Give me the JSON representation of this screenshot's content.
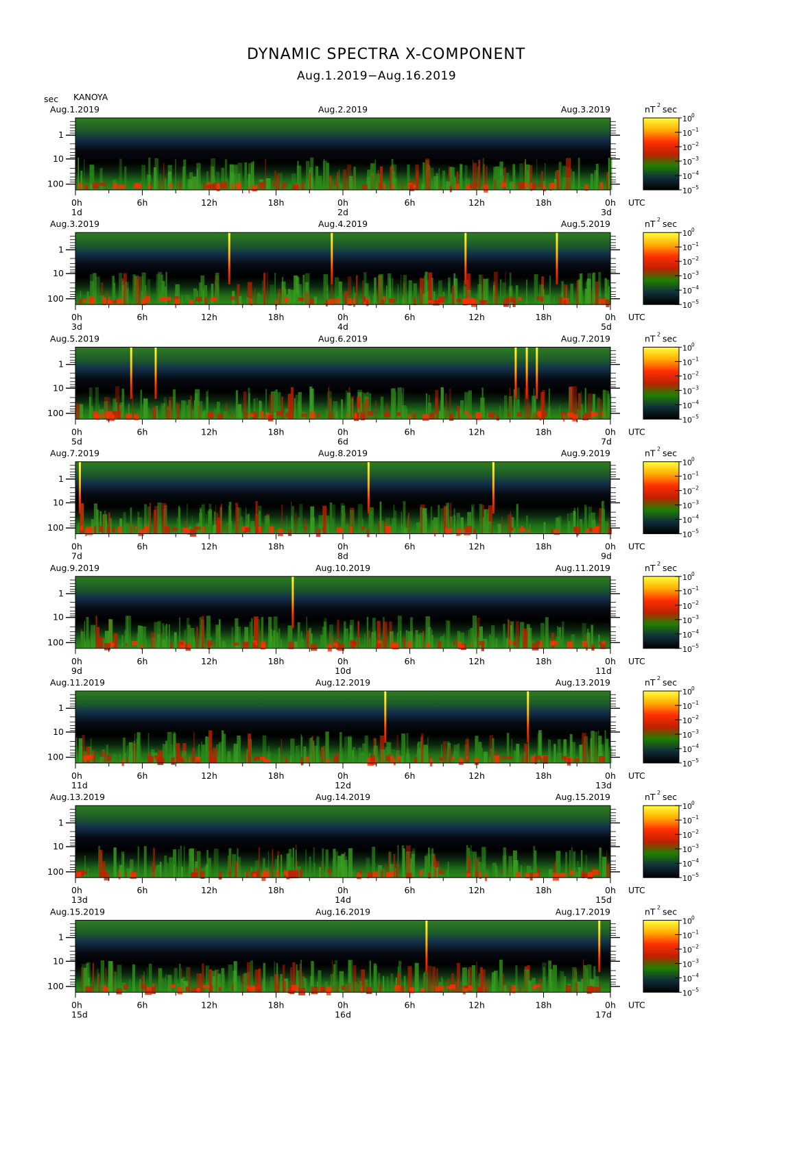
{
  "header": {
    "title": "DYNAMIC SPECTRA X-COMPONENT",
    "subtitle": "Aug.1.2019−Aug.16.2019",
    "yunit": "sec",
    "station": "KANOYA"
  },
  "colorbar": {
    "unit_base": "nT",
    "unit_exp": "2",
    "unit_suffix": "sec",
    "tick_base": "10",
    "tick_exps": [
      "0",
      "−1",
      "−2",
      "−3",
      "−4",
      "−5"
    ],
    "colors": [
      "#ffff40",
      "#ffb000",
      "#ff3000",
      "#c02000",
      "#208000",
      "#10303a",
      "#000000"
    ]
  },
  "axis": {
    "x_ticks": [
      "0h",
      "6h",
      "12h",
      "18h",
      "0h",
      "6h",
      "12h",
      "18h",
      "0h"
    ],
    "utc_label": "UTC",
    "y_ticks": [
      "1",
      "10",
      "100"
    ]
  },
  "chart_data": {
    "type": "heatmap",
    "quantity": "Power spectral density of geomagnetic X-component",
    "x_unit": "hour UTC",
    "y_unit": "period (sec)",
    "y_scale": "log",
    "ylim_period_sec": [
      0.2,
      200
    ],
    "color_scale": "log",
    "color_range": [
      1e-05,
      1
    ],
    "panels": [
      {
        "left_date": "Aug.1.2019",
        "mid_date": "Aug.2.2019",
        "right_date": "Aug.3.2019",
        "day_labels": [
          "1d",
          "2d",
          "3d"
        ],
        "spikes_hour": []
      },
      {
        "left_date": "Aug.3.2019",
        "mid_date": "Aug.4.2019",
        "right_date": "Aug.5.2019",
        "day_labels": [
          "3d",
          "4d",
          "5d"
        ],
        "spikes_hour": [
          13.8,
          23.0,
          35.0,
          43.2
        ]
      },
      {
        "left_date": "Aug.5.2019",
        "mid_date": "Aug.6.2019",
        "right_date": "Aug.7.2019",
        "day_labels": [
          "5d",
          "6d",
          "7d"
        ],
        "spikes_hour": [
          5.0,
          7.2,
          39.5,
          40.5,
          41.4
        ]
      },
      {
        "left_date": "Aug.7.2019",
        "mid_date": "Aug.8.2019",
        "right_date": "Aug.9.2019",
        "day_labels": [
          "7d",
          "8d",
          "9d"
        ],
        "spikes_hour": [
          0.4,
          26.3,
          37.5
        ]
      },
      {
        "left_date": "Aug.9.2019",
        "mid_date": "Aug.10.2019",
        "right_date": "Aug.11.2019",
        "day_labels": [
          "9d",
          "10d",
          "11d"
        ],
        "spikes_hour": [
          19.5
        ]
      },
      {
        "left_date": "Aug.11.2019",
        "mid_date": "Aug.12.2019",
        "right_date": "Aug.13.2019",
        "day_labels": [
          "11d",
          "12d",
          "13d"
        ],
        "spikes_hour": [
          27.8,
          40.6
        ]
      },
      {
        "left_date": "Aug.13.2019",
        "mid_date": "Aug.14.2019",
        "right_date": "Aug.15.2019",
        "day_labels": [
          "13d",
          "14d",
          "15d"
        ],
        "spikes_hour": []
      },
      {
        "left_date": "Aug.15.2019",
        "mid_date": "Aug.16.2019",
        "right_date": "Aug.17.2019",
        "day_labels": [
          "15d",
          "16d",
          "17d"
        ],
        "spikes_hour": [
          31.5,
          47.0
        ]
      }
    ]
  }
}
